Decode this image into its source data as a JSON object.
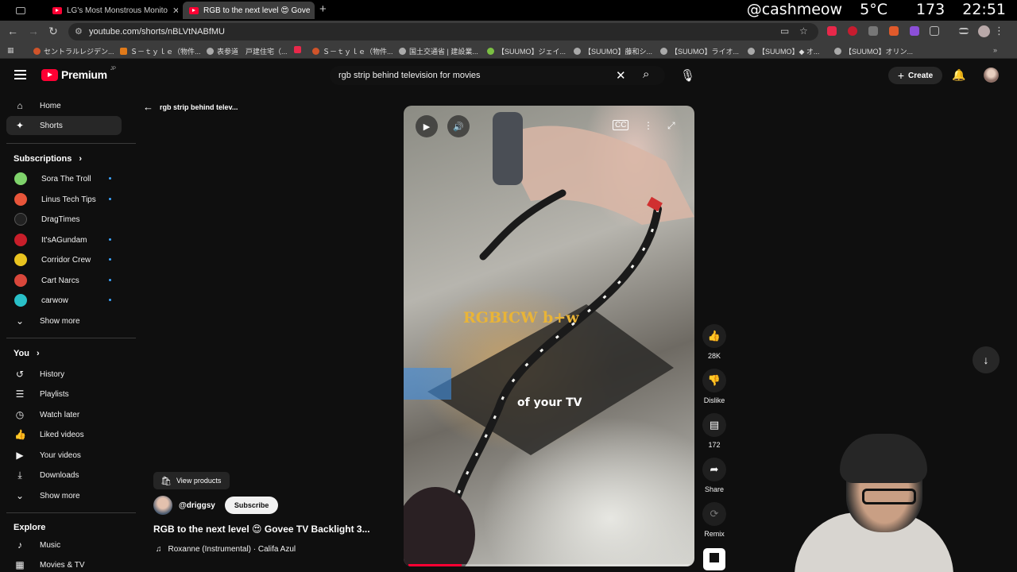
{
  "tabs": [
    {
      "title": "LG's Most Monstrous Monito",
      "active": false
    },
    {
      "title": "RGB to the next level 😍 Gove",
      "active": true
    }
  ],
  "os_tray": {
    "handle": "@cashmeow",
    "temp": "5°C",
    "count": "173",
    "time": "22:51"
  },
  "address_bar": {
    "url": "youtube.com/shorts/nBLVtNABfMU"
  },
  "bookmarks": [
    "セントラルレジデン...",
    "Ｓ－ｔｙｌｅ（物件...",
    "表参道　戸建住宅（...",
    "Ｓ－ｔｙｌｅ（物件...",
    "国土交通省 | 建設業...",
    "【SUUMO】ジェイ...",
    "【SUUMO】藤和シ...",
    "【SUUMO】ライオ...",
    "【SUUMO】◆ オ...",
    "【SUUMO】オリン..."
  ],
  "masthead": {
    "logo_text": "Premium",
    "logo_region": "JP",
    "search_query": "rgb strip behind television for movies",
    "create_label": "Create"
  },
  "sidebar": {
    "main": [
      {
        "label": "Home",
        "icon": "home-icon"
      },
      {
        "label": "Shorts",
        "icon": "shorts-icon",
        "active": true
      }
    ],
    "subscriptions_heading": "Subscriptions",
    "subscriptions": [
      {
        "label": "Sora The Troll",
        "color": "#7fd36b",
        "new": true
      },
      {
        "label": "Linus Tech Tips",
        "color": "#e8553a",
        "new": true
      },
      {
        "label": "DragTimes",
        "color": "#222222",
        "new": false
      },
      {
        "label": "It'sAGundam",
        "color": "#c81e2a",
        "new": true
      },
      {
        "label": "Corridor Crew",
        "color": "#e9c31f",
        "new": true
      },
      {
        "label": "Cart Narcs",
        "color": "#d9473b",
        "new": true
      },
      {
        "label": "carwow",
        "color": "#29c0c8",
        "new": true
      }
    ],
    "show_more_1": "Show more",
    "you_heading": "You",
    "you": [
      {
        "label": "History",
        "icon": "history-icon"
      },
      {
        "label": "Playlists",
        "icon": "playlists-icon"
      },
      {
        "label": "Watch later",
        "icon": "watch-later-icon"
      },
      {
        "label": "Liked videos",
        "icon": "liked-videos-icon"
      },
      {
        "label": "Your videos",
        "icon": "your-videos-icon"
      },
      {
        "label": "Downloads",
        "icon": "downloads-icon"
      }
    ],
    "show_more_2": "Show more",
    "explore_heading": "Explore",
    "explore": [
      {
        "label": "Music",
        "icon": "music-icon"
      },
      {
        "label": "Movies & TV",
        "icon": "movies-tv-icon"
      }
    ]
  },
  "shorts": {
    "back_label": "rgb strip behind telev...",
    "overlay_text_1": "RGBICW b+w",
    "overlay_text_2": "of your TV",
    "progress": 0.19,
    "actions": {
      "likes": "28K",
      "dislike": "Dislike",
      "comments": "172",
      "share": "Share",
      "remix": "Remix"
    },
    "view_products": "View products",
    "channel": "@driggsy",
    "subscribe": "Subscribe",
    "title": "RGB to the next level 😍 Govee TV Backlight 3...",
    "music": "Roxanne (Instrumental) · Califa Azul"
  },
  "colors": {
    "accent": "#ff0033",
    "background": "#0f0f0f",
    "new_dot": "#3ea6ff"
  }
}
